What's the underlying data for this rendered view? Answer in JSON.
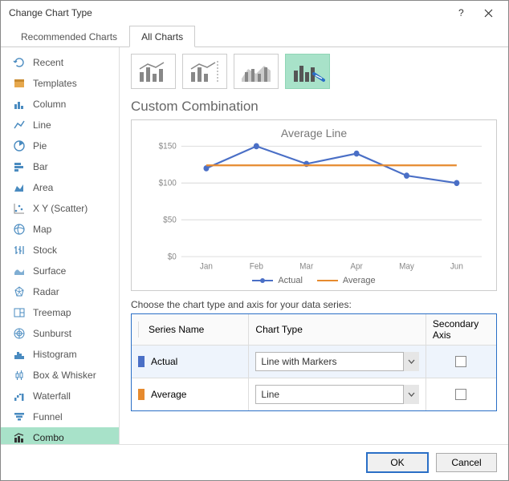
{
  "dialog_title": "Change Chart Type",
  "tabs": {
    "recommended": "Recommended Charts",
    "all": "All Charts"
  },
  "active_tab": "All Charts",
  "sidebar": {
    "items": [
      {
        "label": "Recent"
      },
      {
        "label": "Templates"
      },
      {
        "label": "Column"
      },
      {
        "label": "Line"
      },
      {
        "label": "Pie"
      },
      {
        "label": "Bar"
      },
      {
        "label": "Area"
      },
      {
        "label": "X Y (Scatter)"
      },
      {
        "label": "Map"
      },
      {
        "label": "Stock"
      },
      {
        "label": "Surface"
      },
      {
        "label": "Radar"
      },
      {
        "label": "Treemap"
      },
      {
        "label": "Sunburst"
      },
      {
        "label": "Histogram"
      },
      {
        "label": "Box & Whisker"
      },
      {
        "label": "Waterfall"
      },
      {
        "label": "Funnel"
      },
      {
        "label": "Combo"
      }
    ],
    "selected": "Combo"
  },
  "section_title": "Custom Combination",
  "chart_data": {
    "type": "line",
    "title": "Average Line",
    "categories": [
      "Jan",
      "Feb",
      "Mar",
      "Apr",
      "May",
      "Jun"
    ],
    "series": [
      {
        "name": "Actual",
        "values": [
          120,
          150,
          126,
          140,
          110,
          100
        ],
        "color": "#4a6fc6",
        "marker": true,
        "chart_type": "Line with Markers"
      },
      {
        "name": "Average",
        "values": [
          124,
          124,
          124,
          124,
          124,
          124
        ],
        "color": "#e68a2e",
        "marker": false,
        "chart_type": "Line"
      }
    ],
    "ylim": [
      0,
      150
    ],
    "yticks": [
      0,
      50,
      100,
      150
    ],
    "ytick_labels": [
      "$0",
      "$50",
      "$100",
      "$150"
    ]
  },
  "choose_label": "Choose the chart type and axis for your data series:",
  "table": {
    "headers": {
      "series_name": "Series Name",
      "chart_type": "Chart Type",
      "secondary": "Secondary Axis"
    }
  },
  "buttons": {
    "ok": "OK",
    "cancel": "Cancel"
  }
}
